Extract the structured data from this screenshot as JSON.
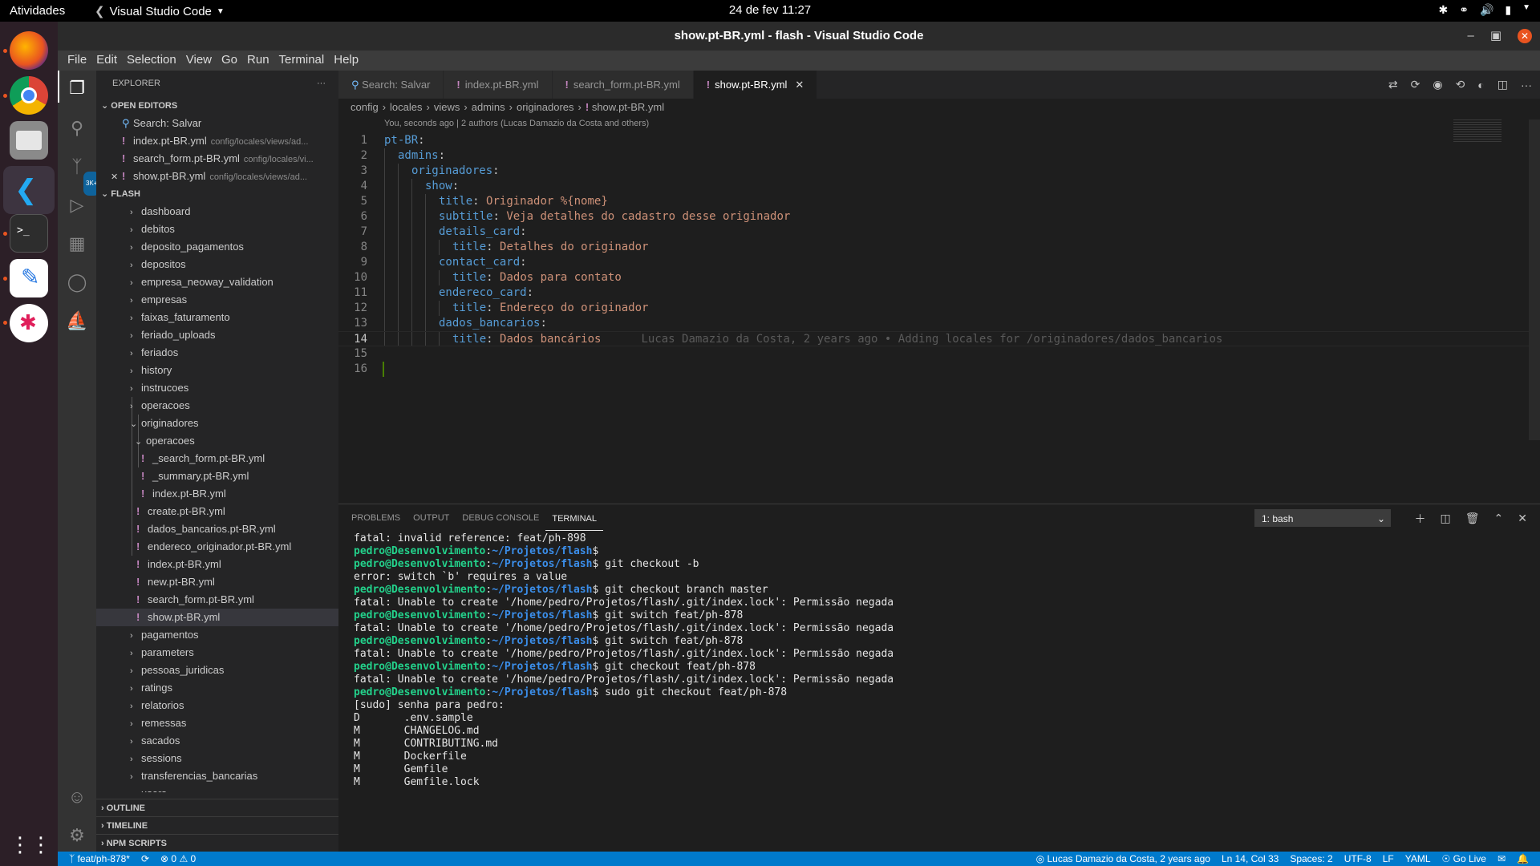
{
  "topbar": {
    "activities": "Atividades",
    "app_name": "Visual Studio Code",
    "clock": "24 de fev  11:27"
  },
  "window": {
    "title": "show.pt-BR.yml - flash - Visual Studio Code"
  },
  "menu": [
    "File",
    "Edit",
    "Selection",
    "View",
    "Go",
    "Run",
    "Terminal",
    "Help"
  ],
  "explorer": {
    "title": "EXPLORER",
    "open_editors_label": "OPEN EDITORS",
    "open_editors": [
      {
        "name": "Search: Salvar",
        "path": ""
      },
      {
        "name": "index.pt-BR.yml",
        "path": "config/locales/views/ad..."
      },
      {
        "name": "search_form.pt-BR.yml",
        "path": "config/locales/vi..."
      },
      {
        "name": "show.pt-BR.yml",
        "path": "config/locales/views/ad..."
      }
    ],
    "folder_label": "FLASH",
    "tree": [
      {
        "name": "dashboard",
        "type": "folder"
      },
      {
        "name": "debitos",
        "type": "folder"
      },
      {
        "name": "deposito_pagamentos",
        "type": "folder"
      },
      {
        "name": "depositos",
        "type": "folder"
      },
      {
        "name": "empresa_neoway_validation",
        "type": "folder"
      },
      {
        "name": "empresas",
        "type": "folder"
      },
      {
        "name": "faixas_faturamento",
        "type": "folder"
      },
      {
        "name": "feriado_uploads",
        "type": "folder"
      },
      {
        "name": "feriados",
        "type": "folder"
      },
      {
        "name": "history",
        "type": "folder"
      },
      {
        "name": "instrucoes",
        "type": "folder"
      },
      {
        "name": "operacoes",
        "type": "folder"
      },
      {
        "name": "originadores",
        "type": "open-folder"
      },
      {
        "name": "operacoes",
        "type": "open-subfolder"
      },
      {
        "name": "_search_form.pt-BR.yml",
        "type": "subfile"
      },
      {
        "name": "_summary.pt-BR.yml",
        "type": "subfile"
      },
      {
        "name": "index.pt-BR.yml",
        "type": "subfile"
      },
      {
        "name": "create.pt-BR.yml",
        "type": "file"
      },
      {
        "name": "dados_bancarios.pt-BR.yml",
        "type": "file"
      },
      {
        "name": "endereco_originador.pt-BR.yml",
        "type": "file"
      },
      {
        "name": "index.pt-BR.yml",
        "type": "file"
      },
      {
        "name": "new.pt-BR.yml",
        "type": "file"
      },
      {
        "name": "search_form.pt-BR.yml",
        "type": "file"
      },
      {
        "name": "show.pt-BR.yml",
        "type": "file-selected"
      },
      {
        "name": "pagamentos",
        "type": "folder"
      },
      {
        "name": "parameters",
        "type": "folder"
      },
      {
        "name": "pessoas_juridicas",
        "type": "folder"
      },
      {
        "name": "ratings",
        "type": "folder"
      },
      {
        "name": "relatorios",
        "type": "folder"
      },
      {
        "name": "remessas",
        "type": "folder"
      },
      {
        "name": "sacados",
        "type": "folder"
      },
      {
        "name": "sessions",
        "type": "folder"
      },
      {
        "name": "transferencias_bancarias",
        "type": "folder"
      },
      {
        "name": "users",
        "type": "open-folder"
      }
    ],
    "bottom_sections": [
      "OUTLINE",
      "TIMELINE",
      "NPM SCRIPTS"
    ]
  },
  "tabs": [
    {
      "label": "Search: Salvar",
      "kind": "search",
      "active": false
    },
    {
      "label": "index.pt-BR.yml",
      "kind": "yml",
      "active": false
    },
    {
      "label": "search_form.pt-BR.yml",
      "kind": "yml",
      "active": false
    },
    {
      "label": "show.pt-BR.yml",
      "kind": "yml",
      "active": true
    }
  ],
  "breadcrumbs": [
    "config",
    "locales",
    "views",
    "admins",
    "originadores",
    "show.pt-BR.yml"
  ],
  "blame_header": "You, seconds ago | 2 authors (Lucas Damazio da Costa and others)",
  "code_lines": [
    {
      "n": "1",
      "indent": 0,
      "key": "pt-BR",
      "val": ""
    },
    {
      "n": "2",
      "indent": 1,
      "key": "admins",
      "val": ""
    },
    {
      "n": "3",
      "indent": 2,
      "key": "originadores",
      "val": ""
    },
    {
      "n": "4",
      "indent": 3,
      "key": "show",
      "val": ""
    },
    {
      "n": "5",
      "indent": 4,
      "key": "title",
      "val": "Originador %{nome}"
    },
    {
      "n": "6",
      "indent": 4,
      "key": "subtitle",
      "val": "Veja detalhes do cadastro desse originador"
    },
    {
      "n": "7",
      "indent": 4,
      "key": "details_card",
      "val": ""
    },
    {
      "n": "8",
      "indent": 5,
      "key": "title",
      "val": "Detalhes do originador"
    },
    {
      "n": "9",
      "indent": 4,
      "key": "contact_card",
      "val": ""
    },
    {
      "n": "10",
      "indent": 5,
      "key": "title",
      "val": "Dados para contato"
    },
    {
      "n": "11",
      "indent": 4,
      "key": "endereco_card",
      "val": ""
    },
    {
      "n": "12",
      "indent": 5,
      "key": "title",
      "val": "Endereço do originador"
    },
    {
      "n": "13",
      "indent": 4,
      "key": "dados_bancarios",
      "val": ""
    },
    {
      "n": "14",
      "indent": 5,
      "key": "title",
      "val": "Dados bancários",
      "blame": "Lucas Damazio da Costa, 2 years ago • Adding locales for /originadores/dados_bancarios"
    },
    {
      "n": "15",
      "indent": 0,
      "key": "",
      "val": ""
    },
    {
      "n": "16",
      "indent": 0,
      "key": "",
      "val": ""
    }
  ],
  "current_line": "14",
  "panel": {
    "tabs": [
      "PROBLEMS",
      "OUTPUT",
      "DEBUG CONSOLE",
      "TERMINAL"
    ],
    "active_tab": "TERMINAL",
    "terminal_select": "1: bash",
    "lines": [
      {
        "t": "out",
        "text": "fatal: invalid reference: feat/ph-898"
      },
      {
        "t": "prompt",
        "user": "pedro@Desenvolvimento",
        "path": "~/Projetos/flash",
        "cmd": ""
      },
      {
        "t": "prompt",
        "user": "pedro@Desenvolvimento",
        "path": "~/Projetos/flash",
        "cmd": " git checkout -b"
      },
      {
        "t": "out",
        "text": "error: switch `b' requires a value"
      },
      {
        "t": "prompt",
        "user": "pedro@Desenvolvimento",
        "path": "~/Projetos/flash",
        "cmd": " git checkout branch master"
      },
      {
        "t": "out",
        "text": "fatal: Unable to create '/home/pedro/Projetos/flash/.git/index.lock': Permissão negada"
      },
      {
        "t": "prompt",
        "user": "pedro@Desenvolvimento",
        "path": "~/Projetos/flash",
        "cmd": " git switch feat/ph-878"
      },
      {
        "t": "out",
        "text": "fatal: Unable to create '/home/pedro/Projetos/flash/.git/index.lock': Permissão negada"
      },
      {
        "t": "prompt",
        "user": "pedro@Desenvolvimento",
        "path": "~/Projetos/flash",
        "cmd": " git switch feat/ph-878"
      },
      {
        "t": "out",
        "text": "fatal: Unable to create '/home/pedro/Projetos/flash/.git/index.lock': Permissão negada"
      },
      {
        "t": "prompt",
        "user": "pedro@Desenvolvimento",
        "path": "~/Projetos/flash",
        "cmd": " git checkout feat/ph-878"
      },
      {
        "t": "out",
        "text": "fatal: Unable to create '/home/pedro/Projetos/flash/.git/index.lock': Permissão negada"
      },
      {
        "t": "prompt",
        "user": "pedro@Desenvolvimento",
        "path": "~/Projetos/flash",
        "cmd": " sudo git checkout feat/ph-878"
      },
      {
        "t": "out",
        "text": "[sudo] senha para pedro:"
      },
      {
        "t": "out",
        "text": "D       .env.sample"
      },
      {
        "t": "out",
        "text": "M       CHANGELOG.md"
      },
      {
        "t": "out",
        "text": "M       CONTRIBUTING.md"
      },
      {
        "t": "out",
        "text": "M       Dockerfile"
      },
      {
        "t": "out",
        "text": "M       Gemfile"
      },
      {
        "t": "out",
        "text": "M       Gemfile.lock"
      }
    ]
  },
  "statusbar": {
    "branch": "feat/ph-878*",
    "errors": "0",
    "warnings": "0",
    "blame": "Lucas Damazio da Costa, 2 years ago",
    "position": "Ln 14, Col 33",
    "spaces": "Spaces: 2",
    "encoding": "UTF-8",
    "eol": "LF",
    "language": "YAML",
    "golive": "Go Live"
  },
  "colors": {
    "accent": "#007acc",
    "ubuntu_orange": "#e95420",
    "yaml_key": "#569cd6",
    "yaml_string": "#ce9178",
    "term_user": "#23d18b",
    "term_path": "#3b8eea"
  }
}
